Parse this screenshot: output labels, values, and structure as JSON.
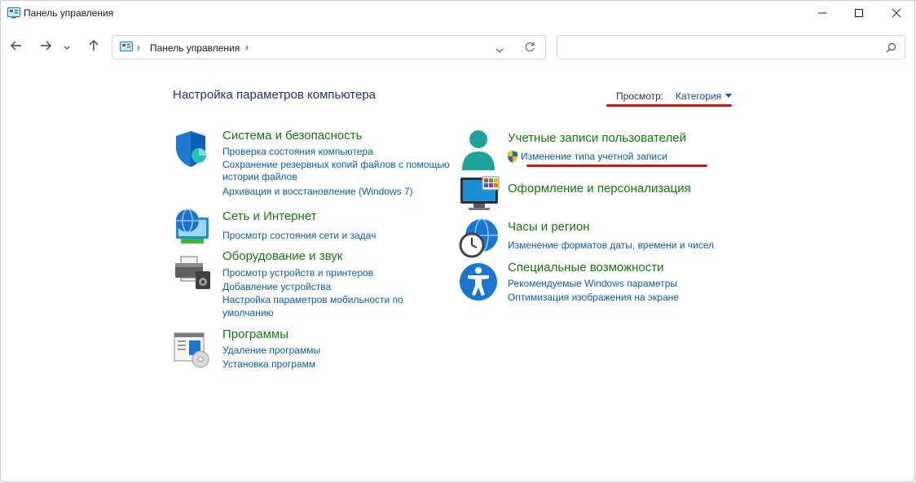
{
  "window": {
    "title": "Панель управления"
  },
  "address": {
    "crumb": "Панель управления",
    "sep": "›"
  },
  "search": {
    "placeholder": ""
  },
  "header": {
    "title": "Настройка параметров компьютера",
    "view_label": "Просмотр:",
    "view_value": "Категория"
  },
  "left": [
    {
      "title": "Система и безопасность",
      "icon": "shield-icon",
      "links": [
        "Проверка состояния компьютера",
        "Сохранение резервных копий файлов с помощью",
        "истории файлов",
        "Архивация и восстановление (Windows 7)"
      ]
    },
    {
      "title": "Сеть и Интернет",
      "icon": "network-globe-icon",
      "links": [
        "Просмотр состояния сети и задач"
      ]
    },
    {
      "title": "Оборудование и звук",
      "icon": "printer-icon",
      "links": [
        "Просмотр устройств и принтеров",
        "Добавление устройства",
        "Настройка параметров мобильности по",
        "умолчанию"
      ]
    },
    {
      "title": "Программы",
      "icon": "programs-icon",
      "links": [
        "Удаление программы",
        "Установка программ"
      ]
    }
  ],
  "right": [
    {
      "title": "Учетные записи пользователей",
      "icon": "user-accounts-icon",
      "links": [
        "Изменение типа учетной записи"
      ]
    },
    {
      "title": "Оформление и персонализация",
      "icon": "monitor-personalization-icon",
      "links": []
    },
    {
      "title": "Часы и регион",
      "icon": "clock-globe-icon",
      "links": [
        "Изменение форматов даты, времени и чисел"
      ]
    },
    {
      "title": "Специальные возможности",
      "icon": "accessibility-icon",
      "links": [
        "Рекомендуемые Windows параметры",
        "Оптимизация изображения на экране"
      ]
    }
  ],
  "colors": {
    "link": "#0b5cad",
    "heading": "#14780f",
    "title": "#1e3287",
    "annotation": "#d21616"
  }
}
